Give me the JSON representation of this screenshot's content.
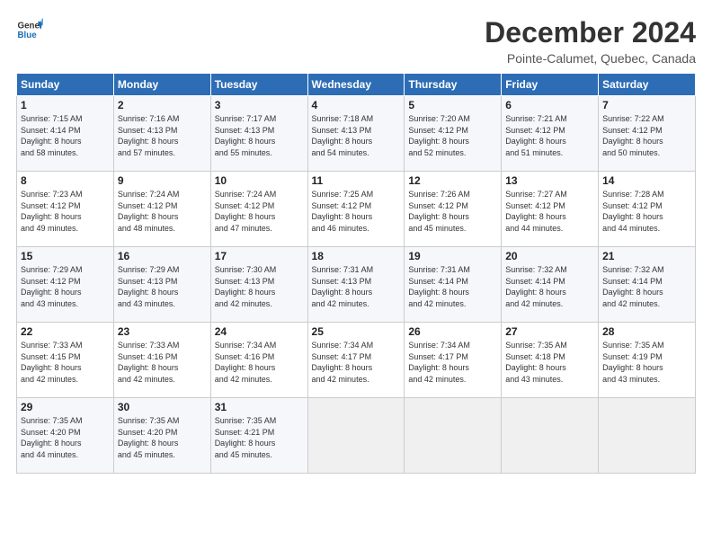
{
  "logo": {
    "line1": "General",
    "line2": "Blue"
  },
  "title": "December 2024",
  "subtitle": "Pointe-Calumet, Quebec, Canada",
  "days_of_week": [
    "Sunday",
    "Monday",
    "Tuesday",
    "Wednesday",
    "Thursday",
    "Friday",
    "Saturday"
  ],
  "weeks": [
    [
      {
        "day": "1",
        "sunrise": "7:15 AM",
        "sunset": "4:14 PM",
        "daylight": "8 hours and 58 minutes."
      },
      {
        "day": "2",
        "sunrise": "7:16 AM",
        "sunset": "4:13 PM",
        "daylight": "8 hours and 57 minutes."
      },
      {
        "day": "3",
        "sunrise": "7:17 AM",
        "sunset": "4:13 PM",
        "daylight": "8 hours and 55 minutes."
      },
      {
        "day": "4",
        "sunrise": "7:18 AM",
        "sunset": "4:13 PM",
        "daylight": "8 hours and 54 minutes."
      },
      {
        "day": "5",
        "sunrise": "7:20 AM",
        "sunset": "4:12 PM",
        "daylight": "8 hours and 52 minutes."
      },
      {
        "day": "6",
        "sunrise": "7:21 AM",
        "sunset": "4:12 PM",
        "daylight": "8 hours and 51 minutes."
      },
      {
        "day": "7",
        "sunrise": "7:22 AM",
        "sunset": "4:12 PM",
        "daylight": "8 hours and 50 minutes."
      }
    ],
    [
      {
        "day": "8",
        "sunrise": "7:23 AM",
        "sunset": "4:12 PM",
        "daylight": "8 hours and 49 minutes."
      },
      {
        "day": "9",
        "sunrise": "7:24 AM",
        "sunset": "4:12 PM",
        "daylight": "8 hours and 48 minutes."
      },
      {
        "day": "10",
        "sunrise": "7:24 AM",
        "sunset": "4:12 PM",
        "daylight": "8 hours and 47 minutes."
      },
      {
        "day": "11",
        "sunrise": "7:25 AM",
        "sunset": "4:12 PM",
        "daylight": "8 hours and 46 minutes."
      },
      {
        "day": "12",
        "sunrise": "7:26 AM",
        "sunset": "4:12 PM",
        "daylight": "8 hours and 45 minutes."
      },
      {
        "day": "13",
        "sunrise": "7:27 AM",
        "sunset": "4:12 PM",
        "daylight": "8 hours and 44 minutes."
      },
      {
        "day": "14",
        "sunrise": "7:28 AM",
        "sunset": "4:12 PM",
        "daylight": "8 hours and 44 minutes."
      }
    ],
    [
      {
        "day": "15",
        "sunrise": "7:29 AM",
        "sunset": "4:12 PM",
        "daylight": "8 hours and 43 minutes."
      },
      {
        "day": "16",
        "sunrise": "7:29 AM",
        "sunset": "4:13 PM",
        "daylight": "8 hours and 43 minutes."
      },
      {
        "day": "17",
        "sunrise": "7:30 AM",
        "sunset": "4:13 PM",
        "daylight": "8 hours and 42 minutes."
      },
      {
        "day": "18",
        "sunrise": "7:31 AM",
        "sunset": "4:13 PM",
        "daylight": "8 hours and 42 minutes."
      },
      {
        "day": "19",
        "sunrise": "7:31 AM",
        "sunset": "4:14 PM",
        "daylight": "8 hours and 42 minutes."
      },
      {
        "day": "20",
        "sunrise": "7:32 AM",
        "sunset": "4:14 PM",
        "daylight": "8 hours and 42 minutes."
      },
      {
        "day": "21",
        "sunrise": "7:32 AM",
        "sunset": "4:14 PM",
        "daylight": "8 hours and 42 minutes."
      }
    ],
    [
      {
        "day": "22",
        "sunrise": "7:33 AM",
        "sunset": "4:15 PM",
        "daylight": "8 hours and 42 minutes."
      },
      {
        "day": "23",
        "sunrise": "7:33 AM",
        "sunset": "4:16 PM",
        "daylight": "8 hours and 42 minutes."
      },
      {
        "day": "24",
        "sunrise": "7:34 AM",
        "sunset": "4:16 PM",
        "daylight": "8 hours and 42 minutes."
      },
      {
        "day": "25",
        "sunrise": "7:34 AM",
        "sunset": "4:17 PM",
        "daylight": "8 hours and 42 minutes."
      },
      {
        "day": "26",
        "sunrise": "7:34 AM",
        "sunset": "4:17 PM",
        "daylight": "8 hours and 42 minutes."
      },
      {
        "day": "27",
        "sunrise": "7:35 AM",
        "sunset": "4:18 PM",
        "daylight": "8 hours and 43 minutes."
      },
      {
        "day": "28",
        "sunrise": "7:35 AM",
        "sunset": "4:19 PM",
        "daylight": "8 hours and 43 minutes."
      }
    ],
    [
      {
        "day": "29",
        "sunrise": "7:35 AM",
        "sunset": "4:20 PM",
        "daylight": "8 hours and 44 minutes."
      },
      {
        "day": "30",
        "sunrise": "7:35 AM",
        "sunset": "4:20 PM",
        "daylight": "8 hours and 45 minutes."
      },
      {
        "day": "31",
        "sunrise": "7:35 AM",
        "sunset": "4:21 PM",
        "daylight": "8 hours and 45 minutes."
      },
      null,
      null,
      null,
      null
    ]
  ]
}
